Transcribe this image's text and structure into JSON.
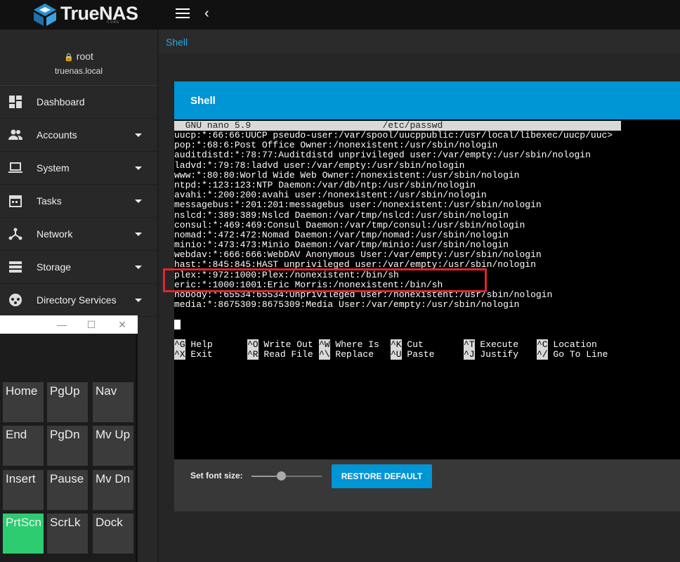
{
  "app": {
    "brand": "TrueNAS",
    "brand_sub": "CORE"
  },
  "user": {
    "name": "root",
    "host": "truenas.local"
  },
  "nav": [
    {
      "label": "Dashboard",
      "icon": "dashboard-icon",
      "expandable": false
    },
    {
      "label": "Accounts",
      "icon": "people-icon",
      "expandable": true
    },
    {
      "label": "System",
      "icon": "laptop-icon",
      "expandable": true
    },
    {
      "label": "Tasks",
      "icon": "calendar-icon",
      "expandable": true
    },
    {
      "label": "Network",
      "icon": "network-icon",
      "expandable": true
    },
    {
      "label": "Storage",
      "icon": "storage-icon",
      "expandable": true
    },
    {
      "label": "Directory Services",
      "icon": "directory-icon",
      "expandable": true
    }
  ],
  "breadcrumb": "Shell",
  "card": {
    "title": "Shell"
  },
  "terminal": {
    "header": "  GNU nano 5.9                        /etc/passwd",
    "lines": [
      "uucp:*:66:66:UUCP pseudo-user:/var/spool/uucppublic:/usr/local/libexec/uucp/uuc>",
      "pop:*:68:6:Post Office Owner:/nonexistent:/usr/sbin/nologin",
      "auditdistd:*:78:77:Auditdistd unprivileged user:/var/empty:/usr/sbin/nologin",
      "ladvd:*:79:78:ladvd user:/var/empty:/usr/sbin/nologin",
      "www:*:80:80:World Wide Web Owner:/nonexistent:/usr/sbin/nologin",
      "ntpd:*:123:123:NTP Daemon:/var/db/ntp:/usr/sbin/nologin",
      "avahi:*:200:200:avahi user:/nonexistent:/usr/sbin/nologin",
      "messagebus:*:201:201:messagebus user:/nonexistent:/usr/sbin/nologin",
      "nslcd:*:389:389:Nslcd Daemon:/var/tmp/nslcd:/usr/sbin/nologin",
      "consul:*:469:469:Consul Daemon:/var/tmp/consul:/usr/sbin/nologin",
      "nomad:*:472:472:Nomad Daemon:/var/tmp/nomad:/usr/sbin/nologin",
      "minio:*:473:473:Minio Daemon:/var/tmp/minio:/usr/sbin/nologin",
      "webdav:*:666:666:WebDAV Anonymous User:/var/empty:/usr/sbin/nologin",
      "hast:*:845:845:HAST unprivileged user:/var/empty:/usr/sbin/nologin",
      "plex:*:972:1000:Plex:/nonexistent:/bin/sh",
      "eric:*:1000:1001:Eric Morris:/nonexistent:/bin/sh",
      "nobody:*:65534:65534:Unprivileged user:/nonexistent:/usr/sbin/nologin",
      "media:*:8675309:8675309:Media User:/var/empty:/usr/sbin/nologin"
    ],
    "shortcuts": [
      {
        "key": "^G",
        "label": " Help"
      },
      {
        "key": "^O",
        "label": " Write Out"
      },
      {
        "key": "^W",
        "label": " Where Is"
      },
      {
        "key": "^K",
        "label": " Cut"
      },
      {
        "key": "^T",
        "label": " Execute"
      },
      {
        "key": "^C",
        "label": " Location"
      },
      {
        "key": "^X",
        "label": " Exit"
      },
      {
        "key": "^R",
        "label": " Read File"
      },
      {
        "key": "^\\",
        "label": " Replace"
      },
      {
        "key": "^U",
        "label": " Paste"
      },
      {
        "key": "^J",
        "label": " Justify"
      },
      {
        "key": "^/",
        "label": " Go To Line"
      }
    ]
  },
  "font_size": {
    "label": "Set font size:",
    "level": 0.42
  },
  "restore_button": "RESTORE DEFAULT",
  "osk": {
    "minimize": "—",
    "maximize": "☐",
    "close": "✕",
    "keys": [
      {
        "label": "Home",
        "active": false
      },
      {
        "label": "PgUp",
        "active": false
      },
      {
        "label": "Nav",
        "active": false
      },
      {
        "label": "End",
        "active": false
      },
      {
        "label": "PgDn",
        "active": false
      },
      {
        "label": "Mv Up",
        "active": false
      },
      {
        "label": "Insert",
        "active": false
      },
      {
        "label": "Pause",
        "active": false
      },
      {
        "label": "Mv Dn",
        "active": false
      },
      {
        "label": "PrtScn",
        "active": true
      },
      {
        "label": "ScrLk",
        "active": false
      },
      {
        "label": "Dock",
        "active": false
      }
    ]
  },
  "colors": {
    "accent": "#0095d5",
    "highlight": "#e0252b",
    "osk_active": "#2ecc71"
  }
}
